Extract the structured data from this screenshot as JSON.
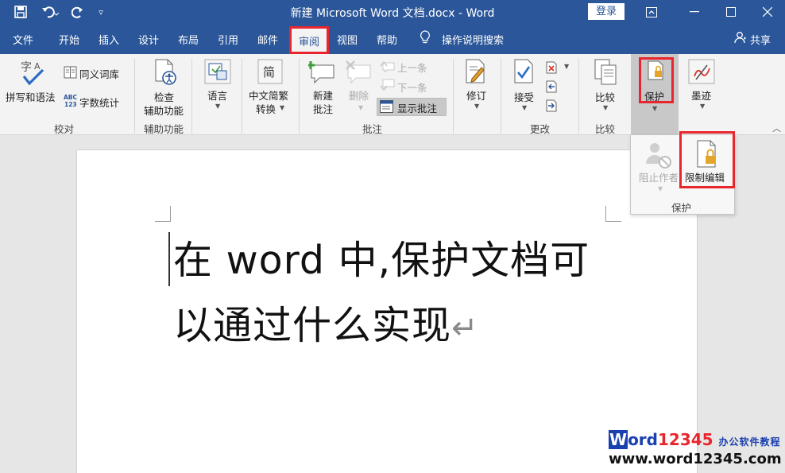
{
  "titlebar": {
    "title": "新建 Microsoft Word 文档.docx  -  Word",
    "login": "登录"
  },
  "menu": {
    "tabs": [
      "文件",
      "开始",
      "插入",
      "设计",
      "布局",
      "引用",
      "邮件",
      "审阅",
      "视图",
      "帮助"
    ],
    "tell_me": "操作说明搜索",
    "share": "共享"
  },
  "ribbon": {
    "proofing": {
      "spelling": "拼写和语法",
      "thesaurus": "同义词库",
      "word_count": "字数统计",
      "group": "校对"
    },
    "accessibility": {
      "check_line1": "检查",
      "check_line2": "辅助功能",
      "group": "辅助功能"
    },
    "language": {
      "label": "语言"
    },
    "chinese": {
      "line1": "中文简繁",
      "line2": "转换"
    },
    "comments": {
      "new_line1": "新建",
      "new_line2": "批注",
      "delete": "删除",
      "prev": "上一条",
      "next": "下一条",
      "show": "显示批注",
      "group": "批注"
    },
    "tracking": {
      "label": "修订"
    },
    "changes": {
      "accept": "接受",
      "group": "更改"
    },
    "compare": {
      "label": "比较",
      "group": "比较"
    },
    "protect": {
      "label": "保护"
    },
    "ink": {
      "label": "墨迹"
    }
  },
  "dropdown": {
    "block_authors": "阻止作者",
    "restrict_editing": "限制编辑",
    "group": "保护"
  },
  "document": {
    "line1": "在 word 中,保护文档可",
    "line2": "以通过什么实现",
    "para_mark": "↵"
  },
  "watermark": {
    "w": "W",
    "ord": "ord",
    "digits": "12345",
    "cn": "办公软件教程",
    "url": "www.word12345.com"
  }
}
